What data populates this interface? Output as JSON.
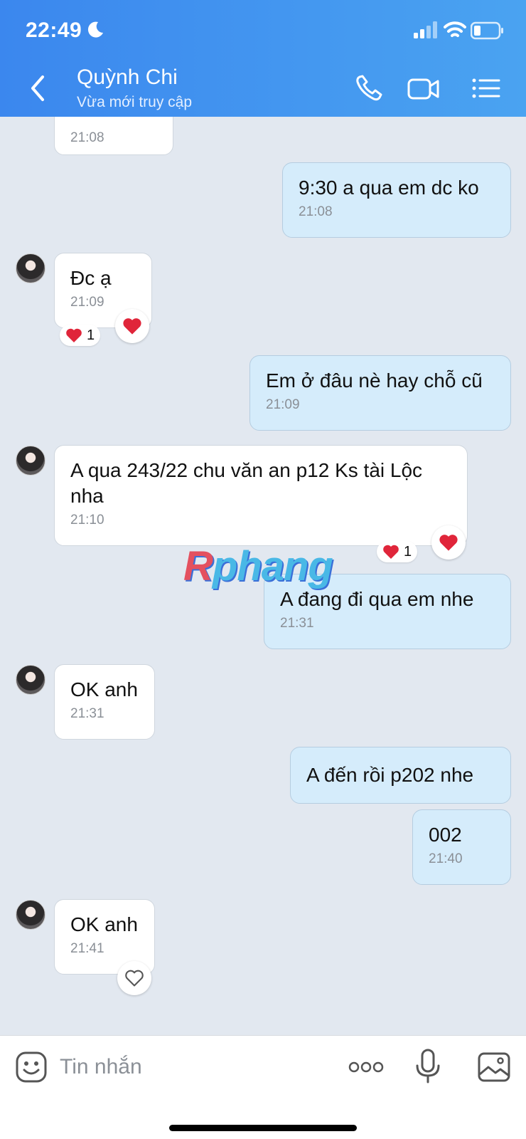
{
  "status_bar": {
    "time": "22:49"
  },
  "header": {
    "contact_name": "Quỳnh Chi",
    "contact_status": "Vừa mới truy cập"
  },
  "messages": [
    {
      "direction": "in",
      "text": "",
      "time": "21:08"
    },
    {
      "direction": "out",
      "text": "9:30 a qua em dc ko",
      "time": "21:08"
    },
    {
      "direction": "in",
      "text": "Đc ạ",
      "time": "21:09",
      "reaction_count": "1"
    },
    {
      "direction": "out",
      "text": "Em ở đâu nè hay chỗ cũ",
      "time": "21:09"
    },
    {
      "direction": "in",
      "text_line1": "A qua 243/22 chu văn an p12 Ks tài Lộc",
      "text_line2": "nha",
      "time": "21:10",
      "reaction_count": "1"
    },
    {
      "direction": "out",
      "text": "A đang đi qua em nhe",
      "time": "21:31"
    },
    {
      "direction": "in",
      "text": "OK anh",
      "time": "21:31"
    },
    {
      "direction": "out",
      "text": "A đến rồi p202 nhe",
      "time": ""
    },
    {
      "direction": "out",
      "text": "002",
      "time": "21:40"
    },
    {
      "direction": "in",
      "text": "OK anh",
      "time": "21:41"
    }
  ],
  "watermark": {
    "first": "R",
    "rest": "phang"
  },
  "input": {
    "placeholder": "Tin nhắn"
  },
  "icons": {
    "back": "chevron-left-icon",
    "call": "phone-icon",
    "video": "video-icon",
    "menu": "list-icon",
    "sticker": "sticker-icon",
    "more": "more-dots-icon",
    "mic": "microphone-icon",
    "image": "image-icon",
    "heart": "heart-icon"
  },
  "colors": {
    "header_start": "#3b87ee",
    "header_end": "#4aa3f1",
    "outgoing_bubble": "#d5ecfb",
    "heart": "#e0253a"
  }
}
